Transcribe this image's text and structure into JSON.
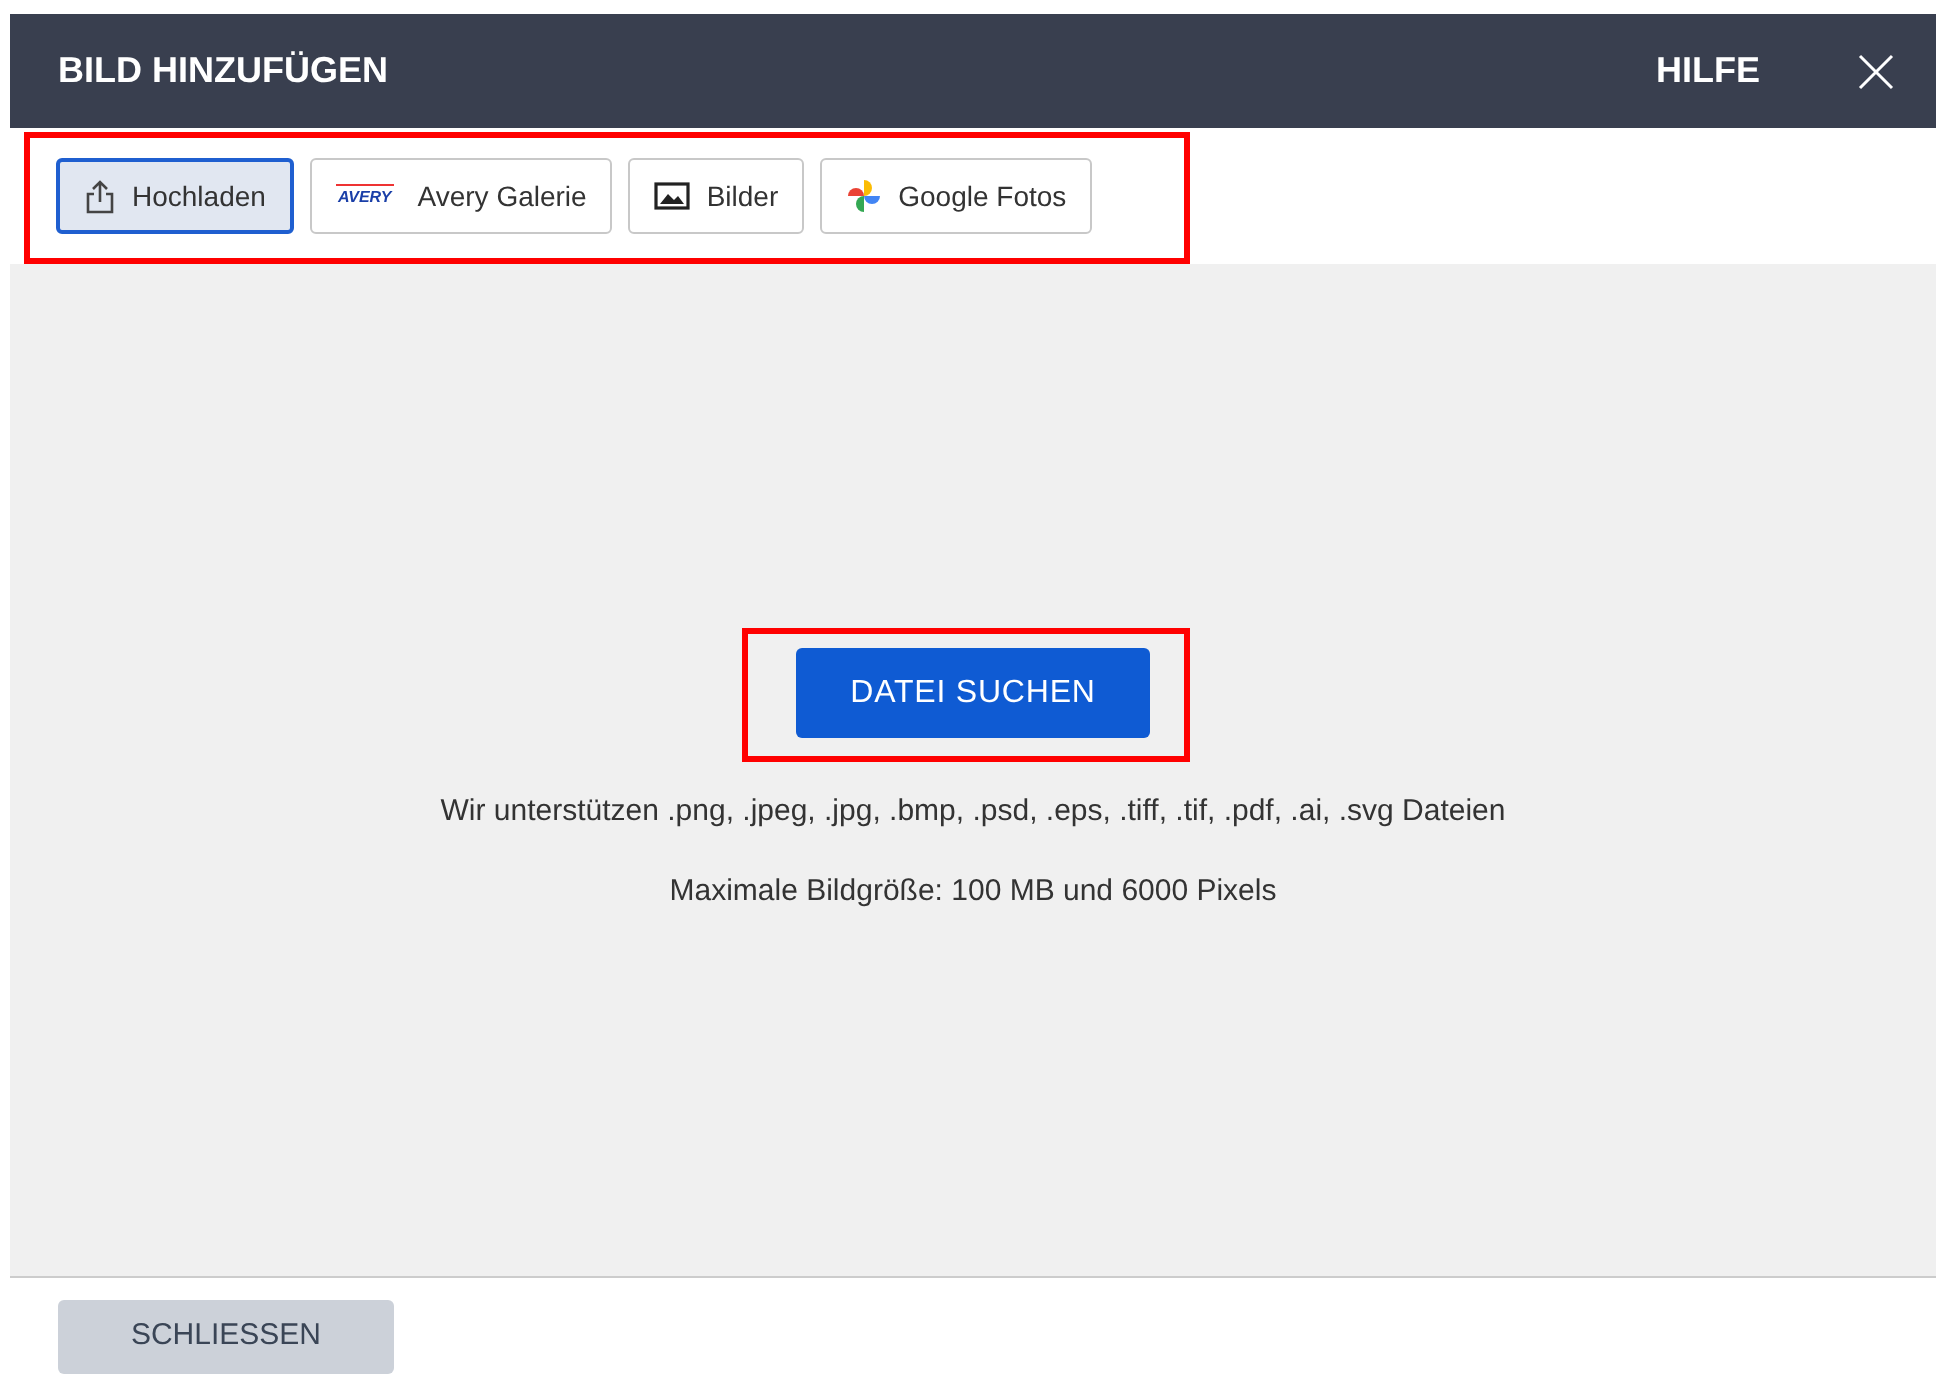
{
  "dialog": {
    "title": "BILD HINZUFÜGEN",
    "help": "HILFE"
  },
  "tabs_highlighted": true,
  "tabs": [
    {
      "kind": "upload",
      "label": "Hochladen",
      "selected": true
    },
    {
      "kind": "avery",
      "logo_text": "AVERY",
      "label": "Avery Galerie",
      "selected": false
    },
    {
      "kind": "image",
      "label": "Bilder",
      "selected": false
    },
    {
      "kind": "pinwheel",
      "label": "Google Fotos",
      "selected": false
    }
  ],
  "upload": {
    "button": "DATEI SUCHEN",
    "highlighted": true,
    "formats": "Wir unterstützen .png, .jpeg, .jpg, .bmp, .psd, .eps, .tiff, .tif, .pdf, .ai, .svg Dateien",
    "limit": "Maximale Bildgröße: 100 MB und 6000 Pixels"
  },
  "footer": {
    "close_button": "SCHLIESSEN"
  }
}
